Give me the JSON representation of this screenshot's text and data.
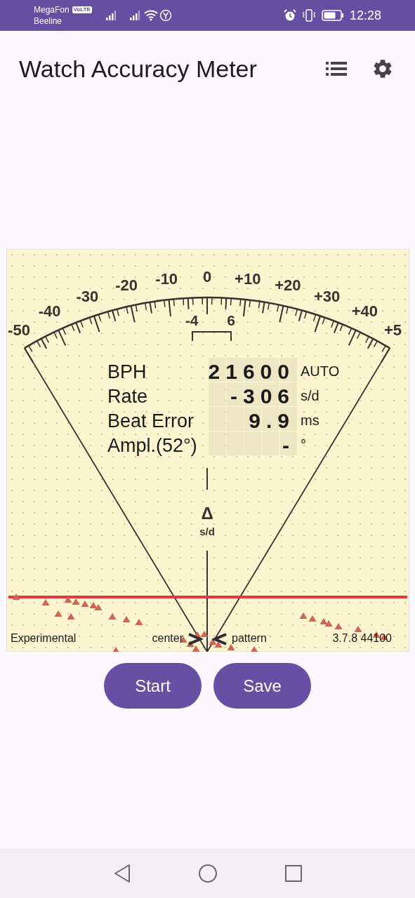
{
  "status_bar": {
    "carriers": [
      "MegaFon",
      "Beeline"
    ],
    "volte": "VoLTE",
    "time": "12:28"
  },
  "app_bar": {
    "title": "Watch Accuracy Meter"
  },
  "meter": {
    "scale_labels": [
      "-50",
      "-40",
      "-30",
      "-20",
      "-10",
      "0",
      "+10",
      "+20",
      "+30",
      "+40",
      "+5"
    ],
    "bracket_labels": [
      "-4",
      "6"
    ],
    "readouts": [
      {
        "label": "BPH",
        "value": "21600",
        "unit": "AUTO"
      },
      {
        "label": "Rate",
        "value": "-306",
        "unit": "s/d"
      },
      {
        "label": "Beat Error",
        "value": "9.9",
        "unit": "ms"
      },
      {
        "label": "Ampl.(52°)",
        "value": "-",
        "unit": "°"
      }
    ],
    "delta_symbol": "Δ",
    "delta_unit": "s/d",
    "footer": {
      "mode": "Experimental",
      "left_marker": "center",
      "right_marker": "pattern",
      "version": "3.7.8 44100"
    }
  },
  "buttons": [
    "Start",
    "Save"
  ]
}
